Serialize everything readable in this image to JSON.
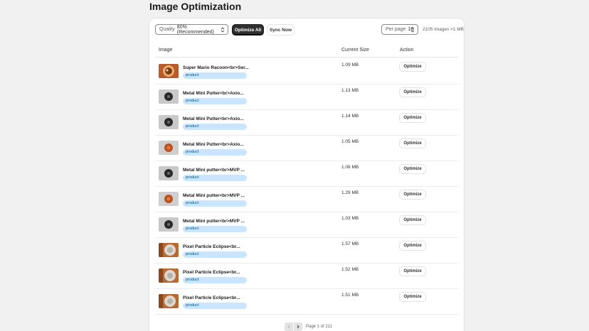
{
  "page": {
    "title": "Image Optimization"
  },
  "toolbar": {
    "quality_label": "Quality",
    "quality_value": "80% (Recommended)",
    "optimize_all_label": "Optimize All",
    "sync_now_label": "Sync Now",
    "per_page_label": "Per page",
    "per_page_value": "10",
    "summary": "2105 images >1 MB"
  },
  "table": {
    "headers": {
      "image": "Image",
      "size": "Current Size",
      "action": "Action"
    },
    "rows": [
      {
        "name": "Super Mario Racoon<br>Ser...",
        "tag": "product",
        "size": "1.09 MB",
        "action": "Optimize",
        "thumb": "mario"
      },
      {
        "name": "Metal Mini Putter<br>Axio...",
        "tag": "product",
        "size": "1.13 MB",
        "action": "Optimize",
        "thumb": "dark"
      },
      {
        "name": "Metal Mini Putter<br>Axio...",
        "tag": "product",
        "size": "1.14 MB",
        "action": "Optimize",
        "thumb": "dark"
      },
      {
        "name": "Metal Mini Putter<br>Axio...",
        "tag": "product",
        "size": "1.05 MB",
        "action": "Optimize",
        "thumb": "orange"
      },
      {
        "name": "Metal Mini putter<br>MVP ...",
        "tag": "product",
        "size": "1.08 MB",
        "action": "Optimize",
        "thumb": "dark"
      },
      {
        "name": "Metal Mini putter<br>MVP ...",
        "tag": "product",
        "size": "1.29 MB",
        "action": "Optimize",
        "thumb": "orange"
      },
      {
        "name": "Metal Mini putter<br>MVP ...",
        "tag": "product",
        "size": "1.03 MB",
        "action": "Optimize",
        "thumb": "dark"
      },
      {
        "name": "Pixel Particle Eclipse<br...",
        "tag": "product",
        "size": "1.57 MB",
        "action": "Optimize",
        "thumb": "eclipse"
      },
      {
        "name": "Pixel Particle Eclipse<br...",
        "tag": "product",
        "size": "1.52 MB",
        "action": "Optimize",
        "thumb": "eclipse"
      },
      {
        "name": "Pixel Particle Eclipse<br...",
        "tag": "product",
        "size": "1.51 MB",
        "action": "Optimize",
        "thumb": "eclipse"
      }
    ]
  },
  "pagination": {
    "text": "Page 1 of 211",
    "prev_icon": "chevron-left-icon",
    "next_icon": "chevron-right-icon"
  },
  "colors": {
    "primary_button": "#303030",
    "badge_bg": "#cce5ff",
    "page_bg": "#f1f1f1"
  }
}
